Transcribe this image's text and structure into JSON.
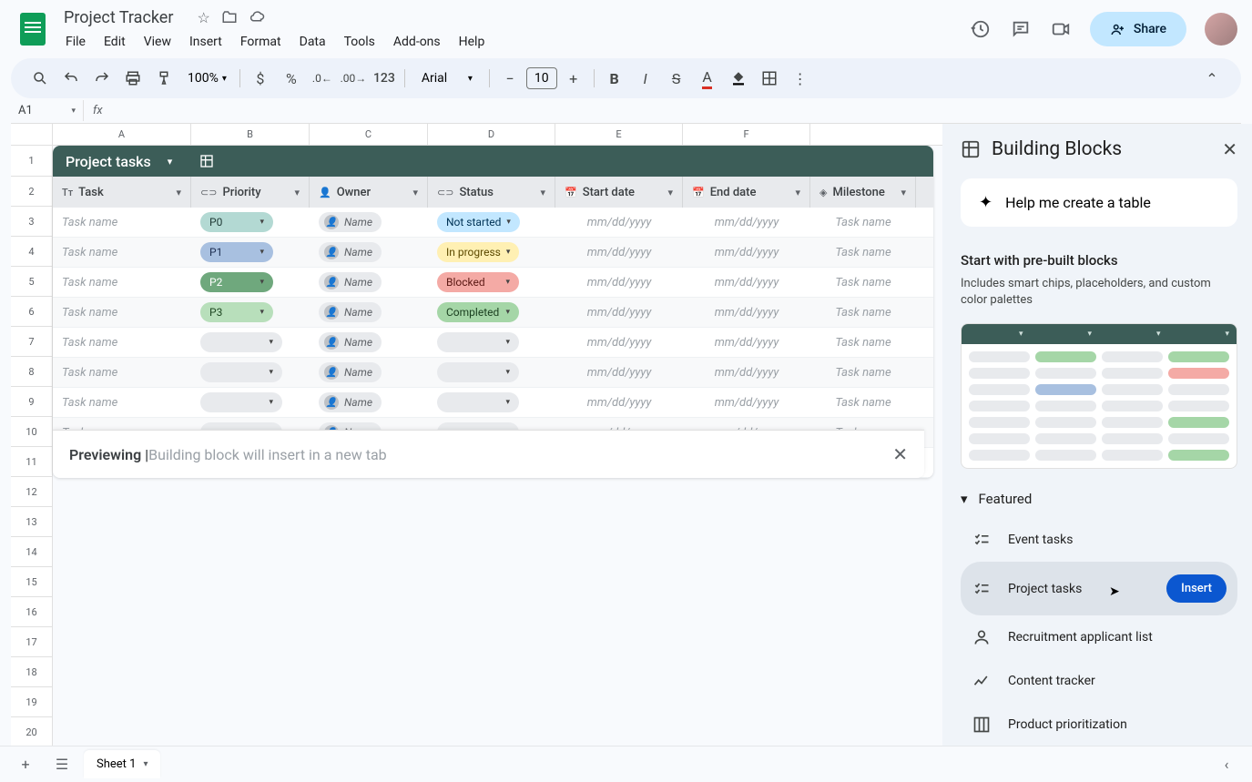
{
  "doc_title": "Project Tracker",
  "menu": [
    "File",
    "Edit",
    "View",
    "Insert",
    "Format",
    "Data",
    "Tools",
    "Add-ons",
    "Help"
  ],
  "toolbar": {
    "zoom": "100%",
    "font": "Arial",
    "font_size": "10",
    "number_format": "123"
  },
  "share_label": "Share",
  "name_box": "A1",
  "columns": [
    "A",
    "B",
    "C",
    "D",
    "E",
    "F"
  ],
  "row_numbers": [
    1,
    2,
    3,
    4,
    5,
    6,
    7,
    8,
    9,
    10,
    11,
    12,
    13,
    14,
    15,
    16,
    17,
    18,
    19,
    20
  ],
  "block": {
    "title": "Project tasks",
    "headers": [
      "Task",
      "Priority",
      "Owner",
      "Status",
      "Start date",
      "End date",
      "Milestone"
    ],
    "task_placeholder": "Task name",
    "owner_placeholder": "Name",
    "date_placeholder": "mm/dd/yyyy",
    "milestone_placeholder": "Task name",
    "rows": [
      {
        "priority": "P0",
        "priority_class": "chip-p0",
        "status": "Not started",
        "status_class": "chip-notstarted"
      },
      {
        "priority": "P1",
        "priority_class": "chip-p1",
        "status": "In progress",
        "status_class": "chip-inprogress"
      },
      {
        "priority": "P2",
        "priority_class": "chip-p2",
        "status": "Blocked",
        "status_class": "chip-blocked"
      },
      {
        "priority": "P3",
        "priority_class": "chip-p3",
        "status": "Completed",
        "status_class": "chip-completed"
      },
      {
        "priority": "",
        "priority_class": "chip-empty",
        "status": "",
        "status_class": "chip-empty"
      },
      {
        "priority": "",
        "priority_class": "chip-empty",
        "status": "",
        "status_class": "chip-empty"
      },
      {
        "priority": "",
        "priority_class": "chip-empty",
        "status": "",
        "status_class": "chip-empty"
      },
      {
        "priority": "",
        "priority_class": "chip-empty",
        "status": "",
        "status_class": "chip-empty"
      },
      {
        "priority": "",
        "priority_class": "chip-empty",
        "status": "",
        "status_class": "chip-empty"
      }
    ]
  },
  "preview_bar": {
    "bold": "Previewing | ",
    "light": "Building block will insert in a new tab"
  },
  "sheet_tab": "Sheet 1",
  "panel": {
    "title": "Building Blocks",
    "help": "Help me create a table",
    "sub": "Start with pre-built blocks",
    "desc": "Includes smart chips, placeholders, and custom color palettes",
    "section": "Featured",
    "features": [
      {
        "label": "Event tasks",
        "icon": "checklist"
      },
      {
        "label": "Project tasks",
        "icon": "checklist",
        "selected": true,
        "insert": "Insert"
      },
      {
        "label": "Recruitment applicant list",
        "icon": "person"
      },
      {
        "label": "Content tracker",
        "icon": "trend"
      },
      {
        "label": "Product prioritization",
        "icon": "board"
      }
    ]
  }
}
